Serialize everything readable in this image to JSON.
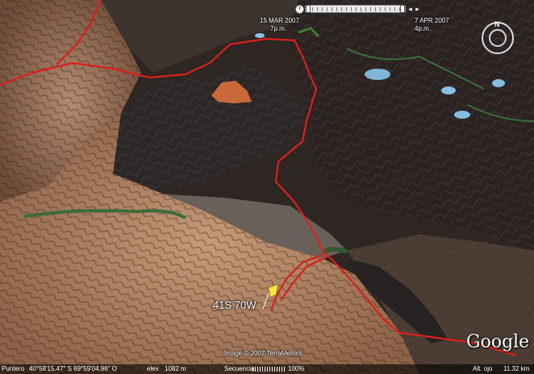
{
  "timeline": {
    "start_date": "15 MAR 2007",
    "start_time": "7p.m.",
    "end_date": "7 APR 2007",
    "end_time": "4p.m.",
    "clock_icon": "clock-icon",
    "back_icon": "step-back-icon",
    "forward_icon": "play-forward-icon"
  },
  "compass": {
    "north_label": "N",
    "icon": "compass-icon"
  },
  "placemark": {
    "label": "41S 70W",
    "icon": "yellow-pushpin-icon",
    "color": "#f5e642"
  },
  "overlay": {
    "copyright": "Image © 2007 TerraMetrics",
    "logo": "Google",
    "path_color": "#d9201c"
  },
  "statusbar": {
    "pointer_label": "Puntero",
    "pointer_coords": "40°58'15.47\" S  69°59'04.96\" O",
    "elev_label": "elev",
    "elev_value": "1082 m",
    "streaming_label": "Secuencia",
    "streaming_percent": "100%",
    "eye_alt_label": "Alt. ojo",
    "eye_alt_value": "11.32 km"
  }
}
